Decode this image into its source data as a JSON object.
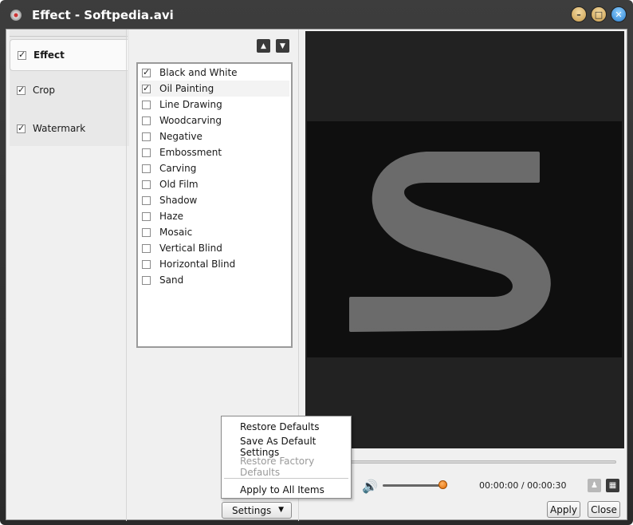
{
  "window": {
    "title": "Effect - Softpedia.avi",
    "controls": {
      "minimize": "–",
      "maximize": "□",
      "close": "✕"
    }
  },
  "nav": {
    "items": [
      {
        "label": "Effect",
        "checked": true,
        "active": true
      },
      {
        "label": "Crop",
        "checked": true,
        "active": false
      },
      {
        "label": "Watermark",
        "checked": true,
        "active": false
      }
    ]
  },
  "move_buttons": {
    "up": "▲",
    "down": "▼"
  },
  "effects": {
    "items": [
      {
        "label": "Black and White",
        "checked": true
      },
      {
        "label": "Oil Painting",
        "checked": true,
        "selected": true
      },
      {
        "label": "Line Drawing",
        "checked": false
      },
      {
        "label": "Woodcarving",
        "checked": false
      },
      {
        "label": "Negative",
        "checked": false
      },
      {
        "label": "Embossment",
        "checked": false
      },
      {
        "label": "Carving",
        "checked": false
      },
      {
        "label": "Old Film",
        "checked": false
      },
      {
        "label": "Shadow",
        "checked": false
      },
      {
        "label": "Haze",
        "checked": false
      },
      {
        "label": "Mosaic",
        "checked": false
      },
      {
        "label": "Vertical Blind",
        "checked": false
      },
      {
        "label": "Horizontal Blind",
        "checked": false
      },
      {
        "label": "Sand",
        "checked": false
      }
    ]
  },
  "playback": {
    "volume_icon": "🔊",
    "time": "00:00:00 / 00:00:30",
    "snapshot_icon": "♟",
    "folder_icon": "▦"
  },
  "settings_menu": {
    "items": [
      {
        "label": "Restore Defaults",
        "enabled": true
      },
      {
        "label": "Save As Default Settings",
        "enabled": true
      },
      {
        "label": "Restore Factory Defaults",
        "enabled": false
      },
      {
        "label": "Apply to All Items",
        "enabled": true
      }
    ]
  },
  "buttons": {
    "settings": "Settings",
    "settings_caret": "▼",
    "apply": "Apply",
    "close": "Close"
  },
  "colors": {
    "accent_orange": "#e06a00",
    "preview_bg": "#222222",
    "frame_bg": "#0f0f0f",
    "letter_gray": "#6b6b6b"
  }
}
